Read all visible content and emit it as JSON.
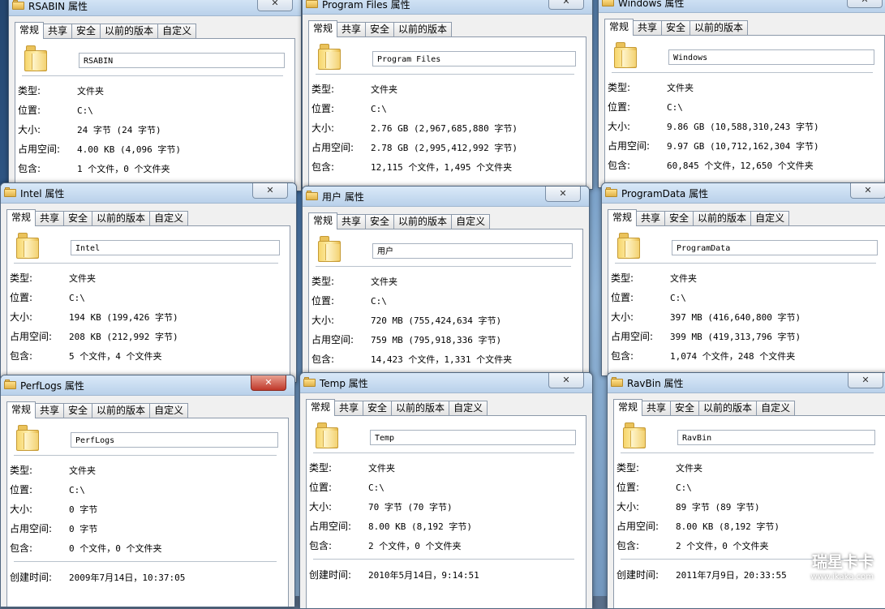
{
  "labels": {
    "type": "类型:",
    "location": "位置:",
    "size": "大小:",
    "disk": "占用空间:",
    "contains": "包含:",
    "created": "创建时间:"
  },
  "windows": [
    {
      "title": "RSABIN 属性",
      "tabs": [
        "常规",
        "共享",
        "安全",
        "以前的版本",
        "自定义"
      ],
      "name": "RSABIN",
      "type": "文件夹",
      "location": "C:\\",
      "size": "24 字节 (24 字节)",
      "disk": "4.00 KB (4,096 字节)",
      "contains": "1 个文件，0 个文件夹"
    },
    {
      "title": "Program Files 属性",
      "tabs": [
        "常规",
        "共享",
        "安全",
        "以前的版本"
      ],
      "name": "Program Files",
      "type": "文件夹",
      "location": "C:\\",
      "size": "2.76 GB (2,967,685,880 字节)",
      "disk": "2.78 GB (2,995,412,992 字节)",
      "contains": "12,115 个文件，1,495 个文件夹"
    },
    {
      "title": "Windows 属性",
      "tabs": [
        "常规",
        "共享",
        "安全",
        "以前的版本"
      ],
      "name": "Windows",
      "type": "文件夹",
      "location": "C:\\",
      "size": "9.86 GB (10,588,310,243 字节)",
      "disk": "9.97 GB (10,712,162,304 字节)",
      "contains": "60,845 个文件，12,650 个文件夹"
    },
    {
      "title": "Intel 属性",
      "tabs": [
        "常规",
        "共享",
        "安全",
        "以前的版本",
        "自定义"
      ],
      "name": "Intel",
      "type": "文件夹",
      "location": "C:\\",
      "size": "194 KB (199,426 字节)",
      "disk": "208 KB (212,992 字节)",
      "contains": "5 个文件，4 个文件夹"
    },
    {
      "title": "用户 属性",
      "tabs": [
        "常规",
        "共享",
        "安全",
        "以前的版本",
        "自定义"
      ],
      "name": "用户",
      "type": "文件夹",
      "location": "C:\\",
      "size": "720 MB (755,424,634 字节)",
      "disk": "759 MB (795,918,336 字节)",
      "contains": "14,423 个文件，1,331 个文件夹"
    },
    {
      "title": "ProgramData 属性",
      "tabs": [
        "常规",
        "共享",
        "安全",
        "以前的版本",
        "自定义"
      ],
      "name": "ProgramData",
      "type": "文件夹",
      "location": "C:\\",
      "size": "397 MB (416,640,800 字节)",
      "disk": "399 MB (419,313,796 字节)",
      "contains": "1,074 个文件，248 个文件夹"
    },
    {
      "title": "PerfLogs 属性",
      "tabs": [
        "常规",
        "共享",
        "安全",
        "以前的版本",
        "自定义"
      ],
      "name": "PerfLogs",
      "type": "文件夹",
      "location": "C:\\",
      "size": "0 字节",
      "disk": "0 字节",
      "contains": "0 个文件，0 个文件夹",
      "created": "2009年7月14日，10:37:05"
    },
    {
      "title": "Temp 属性",
      "tabs": [
        "常规",
        "共享",
        "安全",
        "以前的版本",
        "自定义"
      ],
      "name": "Temp",
      "type": "文件夹",
      "location": "C:\\",
      "size": "70 字节 (70 字节)",
      "disk": "8.00 KB (8,192 字节)",
      "contains": "2 个文件，0 个文件夹",
      "created": "2010年5月14日，9:14:51"
    },
    {
      "title": "RavBin 属性",
      "tabs": [
        "常规",
        "共享",
        "安全",
        "以前的版本",
        "自定义"
      ],
      "name": "RavBin",
      "type": "文件夹",
      "location": "C:\\",
      "size": "89 字节 (89 字节)",
      "disk": "8.00 KB (8,192 字节)",
      "contains": "2 个文件，0 个文件夹",
      "created": "2011年7月9日，20:33:55"
    }
  ],
  "watermark": {
    "brand": "瑞星卡卡",
    "url": "www.ikaka.com"
  }
}
